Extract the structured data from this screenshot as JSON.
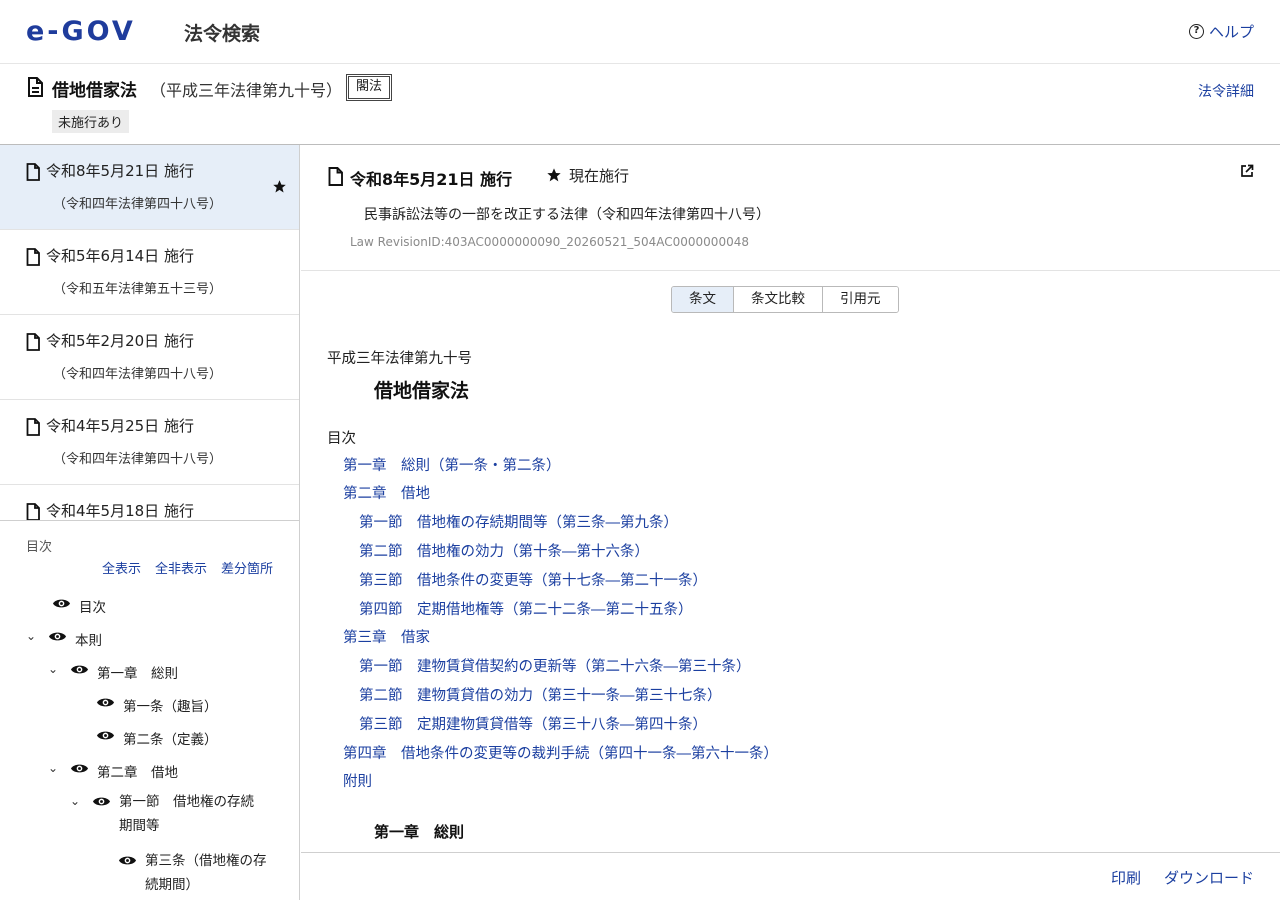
{
  "header": {
    "logo_text": "e-GOV",
    "site_title": "法令検索",
    "help_label": "ヘルプ"
  },
  "law": {
    "title": "借地借家法",
    "number": "（平成三年法律第九十号）",
    "kind_badge": "閣法",
    "status_badge": "未施行あり",
    "detail_link": "法令詳細"
  },
  "revisions": [
    {
      "date": "令和8年5月21日 施行",
      "law": "（令和四年法律第四十八号）",
      "active": true
    },
    {
      "date": "令和5年6月14日 施行",
      "law": "（令和五年法律第五十三号）",
      "active": false
    },
    {
      "date": "令和5年2月20日 施行",
      "law": "（令和四年法律第四十八号）",
      "active": false
    },
    {
      "date": "令和4年5月25日 施行",
      "law": "（令和四年法律第四十八号）",
      "active": false
    },
    {
      "date": "令和4年5月18日 施行",
      "law": "",
      "active": false
    }
  ],
  "toc_panel": {
    "heading": "目次",
    "show_all": "全表示",
    "hide_all": "全非表示",
    "diff": "差分箇所",
    "tree": [
      {
        "label": "目次"
      },
      {
        "label": "本則"
      },
      {
        "label": "第一章　総則"
      },
      {
        "label": "第一条（趣旨）"
      },
      {
        "label": "第二条（定義）"
      },
      {
        "label": "第二章　借地"
      },
      {
        "label": "第一節　借地権の存続期間等"
      },
      {
        "label": "第三条（借地権の存続期間）"
      }
    ]
  },
  "revision_header": {
    "title": "令和8年5月21日 施行",
    "current_label": "現在施行",
    "amending_law": "民事訴訟法等の一部を改正する法律（令和四年法律第四十八号）",
    "revision_id": "Law RevisionID:403AC0000000090_20260521_504AC0000000048"
  },
  "tabs": [
    {
      "label": "条文",
      "active": true
    },
    {
      "label": "条文比較",
      "active": false
    },
    {
      "label": "引用元",
      "active": false
    }
  ],
  "body": {
    "law_number": "平成三年法律第九十号",
    "law_title": "借地借家法",
    "toc_label": "目次",
    "toc": [
      {
        "label": "第一章　総則（第一条・第二条）",
        "level": 1
      },
      {
        "label": "第二章　借地",
        "level": 1
      },
      {
        "label": "第一節　借地権の存続期間等（第三条―第九条）",
        "level": 2
      },
      {
        "label": "第二節　借地権の効力（第十条―第十六条）",
        "level": 2
      },
      {
        "label": "第三節　借地条件の変更等（第十七条―第二十一条）",
        "level": 2
      },
      {
        "label": "第四節　定期借地権等（第二十二条―第二十五条）",
        "level": 2
      },
      {
        "label": "第三章　借家",
        "level": 1
      },
      {
        "label": "第一節　建物賃貸借契約の更新等（第二十六条―第三十条）",
        "level": 2
      },
      {
        "label": "第二節　建物賃貸借の効力（第三十一条―第三十七条）",
        "level": 2
      },
      {
        "label": "第三節　定期建物賃貸借等（第三十八条―第四十条）",
        "level": 2
      },
      {
        "label": "第四章　借地条件の変更等の裁判手続（第四十一条―第六十一条）",
        "level": 1
      },
      {
        "label": "附則",
        "level": 1
      }
    ],
    "chapter1_heading": "第一章　総則"
  },
  "footer": {
    "print": "印刷",
    "download": "ダウンロード"
  }
}
